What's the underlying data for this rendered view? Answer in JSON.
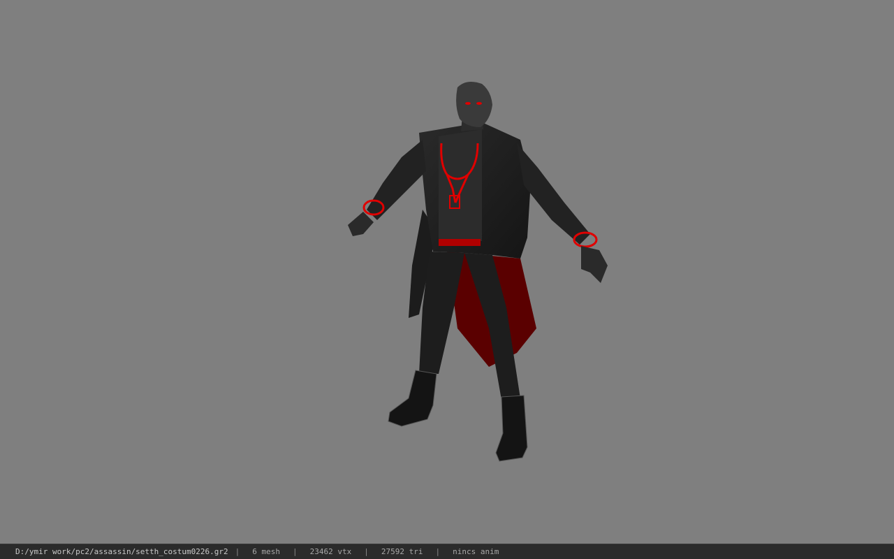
{
  "viewer": {
    "background_color": "#7f7f7f",
    "model": {
      "description_icon": "character-model",
      "accent_color": "#d40000",
      "body_color": "#1b1b1b"
    }
  },
  "statusbar": {
    "file_path": "D:/ymir work/pc2/assassin/setth_costum0226.gr2",
    "separator": "|",
    "mesh": "6 mesh",
    "vtx": "23462 vtx",
    "tri": "27592 tri",
    "anim": "nincs anim"
  }
}
